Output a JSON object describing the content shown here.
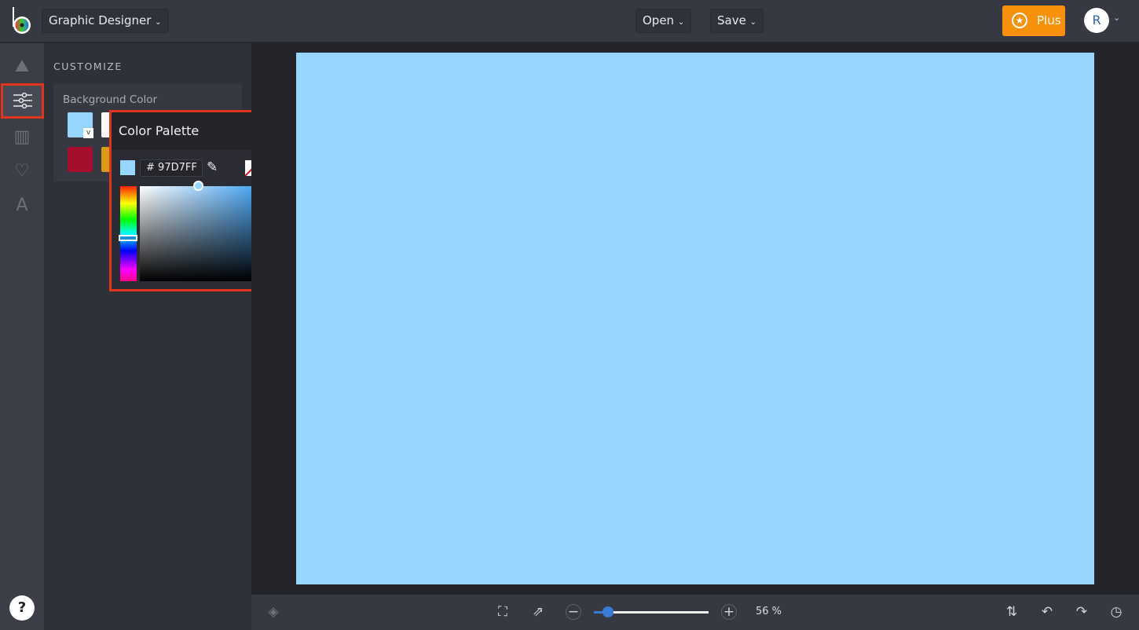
{
  "header": {
    "app_menu": "Graphic Designer",
    "open": "Open",
    "save": "Save",
    "plus": "Plus",
    "avatar_initial": "R"
  },
  "sidebar": {
    "items": [
      {
        "icon": "image-icon"
      },
      {
        "icon": "sliders-icon",
        "active": true
      },
      {
        "icon": "columns-icon"
      },
      {
        "icon": "heart-icon"
      },
      {
        "icon": "text-icon"
      }
    ],
    "help": "?"
  },
  "panel": {
    "title": "CUSTOMIZE",
    "background_label": "Background Color",
    "swatches": [
      "#97D7FF",
      "#FFFFFF",
      "#A50E2D",
      "#D99A18"
    ]
  },
  "palette": {
    "title": "Color Palette",
    "hex_prefix": "#",
    "hex_value": "97D7FF",
    "current_color": "#97D7FF"
  },
  "canvas": {
    "background": "#97D7FF"
  },
  "footer": {
    "zoom_percent": 56,
    "zoom_label": "56 %"
  },
  "colors": {
    "accent": "#F7900A",
    "highlight": "#E0341C",
    "slider": "#3A7BD5"
  }
}
